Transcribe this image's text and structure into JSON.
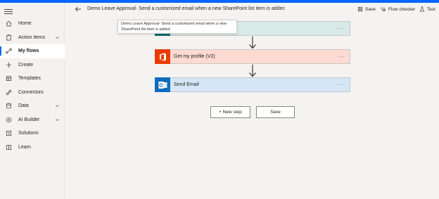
{
  "sidebar": {
    "items": [
      {
        "label": "Home",
        "icon": "home-icon"
      },
      {
        "label": "Action items",
        "icon": "clipboard-icon",
        "expandable": true
      },
      {
        "label": "My flows",
        "icon": "flow-icon",
        "active": true
      },
      {
        "label": "Create",
        "icon": "plus-icon"
      },
      {
        "label": "Templates",
        "icon": "template-icon"
      },
      {
        "label": "Connectors",
        "icon": "connector-icon"
      },
      {
        "label": "Data",
        "icon": "database-icon",
        "expandable": true
      },
      {
        "label": "AI Builder",
        "icon": "ai-builder-icon",
        "expandable": true
      },
      {
        "label": "Solutions",
        "icon": "solutions-icon"
      },
      {
        "label": "Learn",
        "icon": "book-icon"
      }
    ]
  },
  "header": {
    "title": "Demo Leave Approval- Send a customized email when a new SharePoint list item is addec",
    "save_label": "Save",
    "flow_checker_label": "Flow checker",
    "test_label": "Test"
  },
  "tooltip": {
    "text": "Demo Leave Approval- Send a customized email when a new SharePoint list item is added"
  },
  "steps": [
    {
      "label": "",
      "color": "#036c70",
      "bg": "#d7eae8",
      "icon": "sharepoint-icon"
    },
    {
      "label": "Get my profile (V2)",
      "color": "#eb3c00",
      "bg": "#fddad2",
      "icon": "office-icon"
    },
    {
      "label": "Send Email",
      "color": "#0f6cbd",
      "bg": "#d5e7f6",
      "icon": "outlook-icon"
    }
  ],
  "actions": {
    "new_step_label": "+ New step",
    "save_label": "Save"
  },
  "more_label": "···"
}
